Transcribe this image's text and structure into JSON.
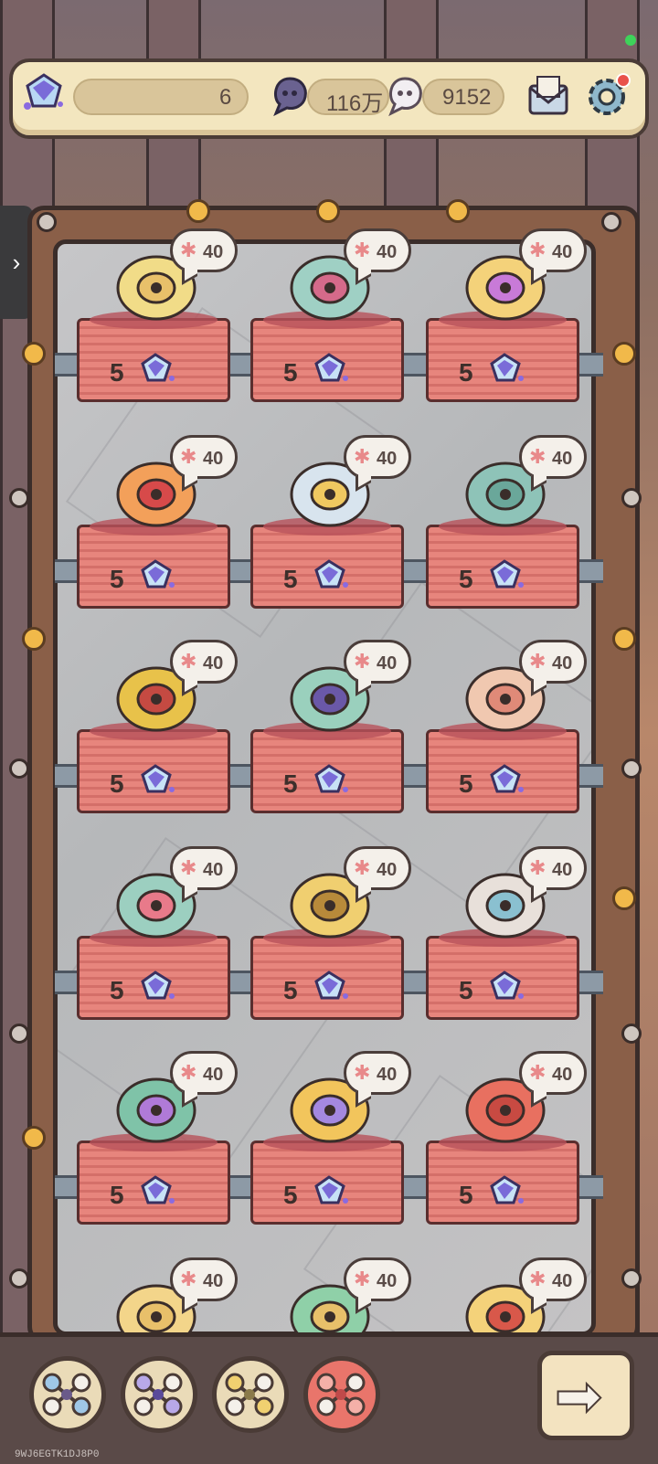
{
  "resources": {
    "gems": "6",
    "dark_souls": "116万",
    "light_souls": "9152"
  },
  "side_tab_arrow": "›",
  "items": [
    {
      "bubble": "40",
      "price": "5",
      "icon": "bone-horn-icon"
    },
    {
      "bubble": "40",
      "price": "5",
      "icon": "crystal-flower-icon"
    },
    {
      "bubble": "40",
      "price": "5",
      "icon": "rainbow-mushroom-icon"
    },
    {
      "bubble": "40",
      "price": "5",
      "icon": "fire-eye-icon"
    },
    {
      "bubble": "40",
      "price": "5",
      "icon": "clock-jar-icon"
    },
    {
      "bubble": "40",
      "price": "5",
      "icon": "horned-hat-icon"
    },
    {
      "bubble": "40",
      "price": "5",
      "icon": "brain-helmet-icon"
    },
    {
      "bubble": "40",
      "price": "5",
      "icon": "serpent-orb-icon"
    },
    {
      "bubble": "40",
      "price": "5",
      "icon": "feather-nest-icon"
    },
    {
      "bubble": "40",
      "price": "5",
      "icon": "spiked-tail-icon"
    },
    {
      "bubble": "40",
      "price": "5",
      "icon": "golden-mask-icon"
    },
    {
      "bubble": "40",
      "price": "5",
      "icon": "pearl-shell-icon"
    },
    {
      "bubble": "40",
      "price": "5",
      "icon": "purple-eye-icon"
    },
    {
      "bubble": "40",
      "price": "5",
      "icon": "gold-compass-icon"
    },
    {
      "bubble": "40",
      "price": "5",
      "icon": "coral-heart-icon"
    },
    {
      "bubble": "40",
      "price": "",
      "icon": "torch-icon"
    },
    {
      "bubble": "40",
      "price": "",
      "icon": "leaf-sprout-icon"
    },
    {
      "bubble": "40",
      "price": "",
      "icon": "red-bulb-icon"
    }
  ],
  "bubble_star": "✱",
  "bottom_tools": [
    {
      "icon": "blue-molecule-icon"
    },
    {
      "icon": "purple-molecule-icon"
    },
    {
      "icon": "yellow-molecule-icon"
    },
    {
      "icon": "red-molecule-icon",
      "active": true
    }
  ],
  "next_arrow": "➡",
  "build_id": "9WJ6EGTK1DJ8P0",
  "colors": {
    "accent": "#e9756b",
    "panel": "#f3e6bf",
    "pedestal": "#e7857d"
  }
}
